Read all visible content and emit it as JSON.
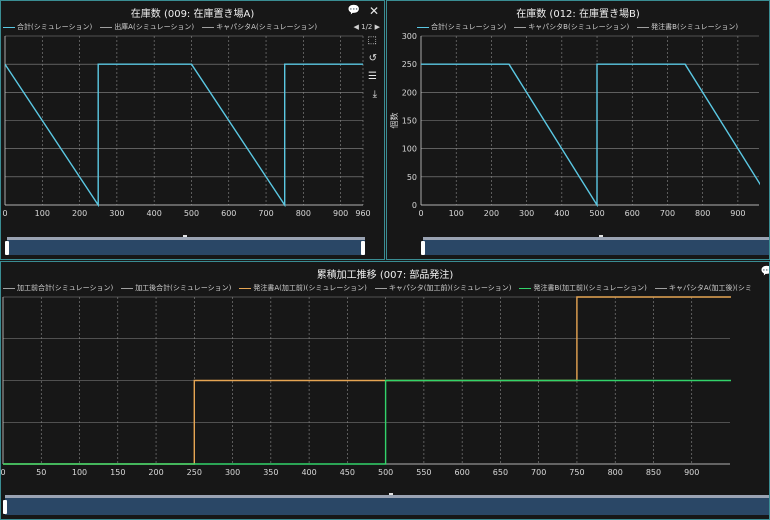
{
  "colors": {
    "cyan": "#5bc8e3",
    "gray": "#a0a0a0",
    "orange": "#e6a553",
    "green": "#32d36a"
  },
  "panel_a": {
    "title": "在庫数 (009: 在庫置き場A)",
    "legend": [
      {
        "name": "合計(シミュレーション)",
        "color": "#5bc8e3"
      },
      {
        "name": "出庫A(シミュレーション)",
        "color": "#a0a0a0"
      },
      {
        "name": "キャパシタA(シミュレーション)",
        "color": "#a0a0a0"
      }
    ],
    "legend_page": "1/2",
    "icons": [
      "comment-icon",
      "close-icon",
      "zoom-area-icon",
      "zoom-reset-icon",
      "data-view-icon",
      "download-icon"
    ]
  },
  "panel_b": {
    "title": "在庫数 (012: 在庫置き場B)",
    "legend": [
      {
        "name": "合計(シミュレーション)",
        "color": "#5bc8e3"
      },
      {
        "name": "キャパシタB(シミュレーション)",
        "color": "#a0a0a0"
      },
      {
        "name": "発注書B(シミュレーション)",
        "color": "#a0a0a0"
      }
    ],
    "ylabel": "個数"
  },
  "panel_c": {
    "title": "累積加工推移 (007: 部品発注)",
    "legend": [
      {
        "name": "加工前合計(シミュレーション)",
        "color": "#a0a0a0"
      },
      {
        "name": "加工後合計(シミュレーション)",
        "color": "#a0a0a0"
      },
      {
        "name": "発注書A(加工前)(シミュレーション)",
        "color": "#e6a553"
      },
      {
        "name": "キャパシタ(加工前)(シミュレーション)",
        "color": "#a0a0a0"
      },
      {
        "name": "発注書B(加工前)(シミュレーション)",
        "color": "#32d36a"
      },
      {
        "name": "キャパシタA(加工後)(シミ",
        "color": "#a0a0a0"
      }
    ]
  },
  "chart_data": [
    {
      "type": "line",
      "title": "在庫数 (009: 在庫置き場A)",
      "xlim": [
        0,
        960
      ],
      "ylim": [
        0,
        300
      ],
      "xticks": [
        0,
        100,
        200,
        300,
        400,
        500,
        600,
        700,
        800,
        900,
        960
      ],
      "yticks": [
        0,
        50,
        100,
        150,
        200,
        250,
        300
      ],
      "show_ytick_labels": false,
      "grid": true,
      "series": [
        {
          "name": "合計(シミュレーション)",
          "color": "#5bc8e3",
          "points": [
            [
              0,
              250
            ],
            [
              250,
              0
            ],
            [
              250,
              250
            ],
            [
              500,
              250
            ],
            [
              750,
              0
            ],
            [
              750,
              250
            ],
            [
              960,
              250
            ]
          ]
        }
      ]
    },
    {
      "type": "line",
      "title": "在庫数 (012: 在庫置き場B)",
      "ylabel": "個数",
      "xlim": [
        0,
        960
      ],
      "ylim": [
        0,
        300
      ],
      "xticks": [
        0,
        100,
        200,
        300,
        400,
        500,
        600,
        700,
        800,
        900
      ],
      "yticks": [
        0,
        50,
        100,
        150,
        200,
        250,
        300
      ],
      "show_ytick_labels": true,
      "grid": true,
      "series": [
        {
          "name": "合計(シミュレーション)",
          "color": "#5bc8e3",
          "points": [
            [
              0,
              250
            ],
            [
              250,
              250
            ],
            [
              500,
              0
            ],
            [
              500,
              250
            ],
            [
              750,
              250
            ],
            [
              1000,
              0
            ]
          ]
        }
      ]
    },
    {
      "type": "line",
      "title": "累積加工推移 (007: 部品発注)",
      "xlim": [
        0,
        950
      ],
      "ylim": [
        0,
        400
      ],
      "xticks": [
        0,
        50,
        100,
        150,
        200,
        250,
        300,
        350,
        400,
        450,
        500,
        550,
        600,
        650,
        700,
        750,
        800,
        850,
        900
      ],
      "yticks": [
        0,
        100,
        200,
        300,
        400
      ],
      "show_ytick_labels": false,
      "grid": true,
      "series": [
        {
          "name": "発注書A(加工前)(シミュレーション)",
          "color": "#e6a553",
          "points": [
            [
              0,
              0
            ],
            [
              250,
              0
            ],
            [
              250,
              200
            ],
            [
              750,
              200
            ],
            [
              750,
              400
            ],
            [
              1000,
              400
            ]
          ]
        },
        {
          "name": "発注書B(加工前)(シミュレーション)",
          "color": "#32d36a",
          "points": [
            [
              0,
              0
            ],
            [
              500,
              0
            ],
            [
              500,
              200
            ],
            [
              1000,
              200
            ]
          ]
        }
      ]
    }
  ]
}
